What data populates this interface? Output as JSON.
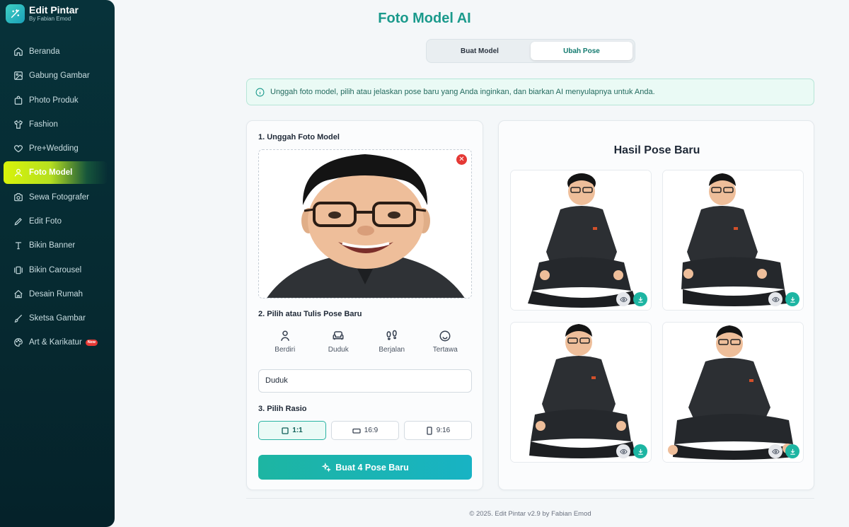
{
  "brand": {
    "title": "Edit Pintar",
    "subtitle": "By Fabian Emod"
  },
  "sidebar": {
    "items": [
      {
        "label": "Beranda",
        "icon": "home-icon"
      },
      {
        "label": "Gabung Gambar",
        "icon": "image-icon"
      },
      {
        "label": "Photo Produk",
        "icon": "shopping-bag-icon"
      },
      {
        "label": "Fashion",
        "icon": "shirt-icon"
      },
      {
        "label": "Pre+Wedding",
        "icon": "heart-icon"
      },
      {
        "label": "Foto Model",
        "icon": "user-icon",
        "active": true
      },
      {
        "label": "Sewa Fotografer",
        "icon": "camera-icon"
      },
      {
        "label": "Edit Foto",
        "icon": "pencil-icon"
      },
      {
        "label": "Bikin Banner",
        "icon": "type-icon"
      },
      {
        "label": "Bikin Carousel",
        "icon": "carousel-icon"
      },
      {
        "label": "Desain Rumah",
        "icon": "house-icon"
      },
      {
        "label": "Sketsa Gambar",
        "icon": "brush-icon"
      },
      {
        "label": "Art & Karikatur",
        "icon": "palette-icon",
        "badge": "New"
      }
    ]
  },
  "header": {
    "title": "Foto Model AI"
  },
  "tabs": [
    {
      "label": "Buat Model",
      "active": false
    },
    {
      "label": "Ubah Pose",
      "active": true
    }
  ],
  "info": {
    "text": "Unggah foto model, pilih atau jelaskan pose baru yang Anda inginkan, dan biarkan AI menyulapnya untuk Anda."
  },
  "left_panel": {
    "step1": "1. Unggah Foto Model",
    "remove_icon": "close-icon",
    "step2": "2. Pilih atau Tulis Pose Baru",
    "poses": [
      {
        "label": "Berdiri",
        "icon": "standing-person-icon"
      },
      {
        "label": "Duduk",
        "icon": "sofa-icon"
      },
      {
        "label": "Berjalan",
        "icon": "footprints-icon"
      },
      {
        "label": "Tertawa",
        "icon": "smile-icon"
      }
    ],
    "pose_input_value": "Duduk",
    "step3": "3. Pilih Rasio",
    "ratios": [
      {
        "label": "1:1",
        "active": true
      },
      {
        "label": "16:9",
        "active": false
      },
      {
        "label": "9:16",
        "active": false
      }
    ],
    "generate_label": "Buat 4 Pose Baru"
  },
  "right_panel": {
    "title": "Hasil Pose Baru",
    "result_count": 4
  },
  "footer": {
    "text": "© 2025. Edit Pintar v2.9 by Fabian Emod"
  },
  "colors": {
    "accent": "#1b9a8c",
    "sidebar_bg": "#07323a",
    "active_nav": "#d8f30a",
    "danger": "#e53935",
    "button": "#1db5a2"
  }
}
